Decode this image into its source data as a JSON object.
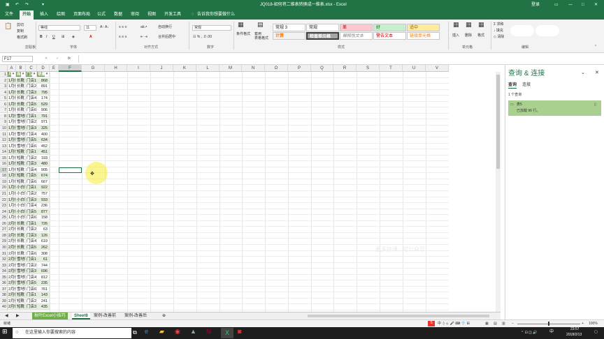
{
  "titlebar": {
    "doc_title": "JQ018-如何将二维表转换成一维表.xlsx - Excel",
    "login": "登录"
  },
  "menu": {
    "items": [
      "文件",
      "开始",
      "插入",
      "绘图",
      "页面布局",
      "公式",
      "数据",
      "审阅",
      "视图",
      "开发工具"
    ],
    "active": 1,
    "tell_me": "告诉我你想要做什么"
  },
  "ribbon": {
    "clipboard": {
      "cut": "剪切",
      "copy": "复制",
      "format_painter": "格式刷",
      "group": "剪贴板"
    },
    "font": {
      "name": "等线",
      "size": "11",
      "group": "字体"
    },
    "alignment": {
      "wrap": "自动换行",
      "merge": "合并后居中",
      "group": "对齐方式"
    },
    "number": {
      "format": "常规",
      "group": "数字"
    },
    "styles": {
      "cond_format": "条件格式",
      "table_format": "套用\n表格格式",
      "boxes": [
        "常规 3",
        "常规",
        "差",
        "好",
        "适中",
        "计算",
        "检查单元格",
        "解释性文本",
        "警告文本",
        "链接单元格"
      ],
      "group": "样式"
    },
    "cells": {
      "insert": "插入",
      "delete": "删除",
      "format": "格式",
      "group": "单元格"
    },
    "editing": {
      "sum": "求和",
      "fill": "填充",
      "clear": "清除",
      "group": "编辑"
    }
  },
  "formula": {
    "namebox": "F17",
    "fx": "fx",
    "content": ""
  },
  "columns": [
    "A",
    "B",
    "C",
    "D",
    "E",
    "F",
    "G",
    "H",
    "I",
    "J",
    "K",
    "L",
    "M",
    "N",
    "O",
    "P",
    "Q",
    "R",
    "S",
    "T",
    "U",
    "V"
  ],
  "header_row": [
    "月份",
    "商品",
    "门店",
    "销量"
  ],
  "rows": [
    [
      "1月份",
      "长靴",
      "门店1",
      "868"
    ],
    [
      "1月份",
      "长靴",
      "门店2",
      "891"
    ],
    [
      "1月份",
      "长靴",
      "门店3",
      "795"
    ],
    [
      "1月份",
      "长靴",
      "门店4",
      "174"
    ],
    [
      "1月份",
      "长靴",
      "门店5",
      "529"
    ],
    [
      "1月份",
      "长靴",
      "门店6",
      "906"
    ],
    [
      "1月份",
      "雪地靴",
      "门店1",
      "791"
    ],
    [
      "1月份",
      "雪地靴",
      "门店2",
      "971"
    ],
    [
      "1月份",
      "雪地靴",
      "门店3",
      "325"
    ],
    [
      "1月份",
      "雪地靴",
      "门店4",
      "400"
    ],
    [
      "1月份",
      "雪地靴",
      "门店5",
      "634"
    ],
    [
      "1月份",
      "雪地靴",
      "门店6",
      "452"
    ],
    [
      "1月份",
      "短靴",
      "门店1",
      "451"
    ],
    [
      "1月份",
      "短靴",
      "门店2",
      "193"
    ],
    [
      "1月份",
      "短靴",
      "门店3",
      "480"
    ],
    [
      "1月份",
      "短靴",
      "门店4",
      "905"
    ],
    [
      "1月份",
      "短靴",
      "门店5",
      "674"
    ],
    [
      "1月份",
      "短靴",
      "门店6",
      "667"
    ],
    [
      "1月份",
      "小白鞋",
      "门店1",
      "922"
    ],
    [
      "1月份",
      "小白鞋",
      "门店2",
      "757"
    ],
    [
      "1月份",
      "小白鞋",
      "门店3",
      "933"
    ],
    [
      "1月份",
      "小白鞋",
      "门店4",
      "236"
    ],
    [
      "1月份",
      "小白鞋",
      "门店5",
      "877"
    ],
    [
      "1月份",
      "小白鞋",
      "门店6",
      "158"
    ],
    [
      "2月份",
      "长靴",
      "门店1",
      "726"
    ],
    [
      "2月份",
      "长靴",
      "门店2",
      "63"
    ],
    [
      "2月份",
      "长靴",
      "门店3",
      "126"
    ],
    [
      "2月份",
      "长靴",
      "门店4",
      "619"
    ],
    [
      "2月份",
      "长靴",
      "门店5",
      "262"
    ],
    [
      "2月份",
      "长靴",
      "门店6",
      "308"
    ],
    [
      "2月份",
      "雪地靴",
      "门店1",
      "61"
    ],
    [
      "2月份",
      "雪地靴",
      "门店2",
      "744"
    ],
    [
      "2月份",
      "雪地靴",
      "门店3",
      "696"
    ],
    [
      "2月份",
      "雪地靴",
      "门店4",
      "812"
    ],
    [
      "2月份",
      "雪地靴",
      "门店5",
      "235"
    ],
    [
      "2月份",
      "雪地靴",
      "门店6",
      "761"
    ],
    [
      "2月份",
      "短靴",
      "门店1",
      "143"
    ],
    [
      "2月份",
      "短靴",
      "门店2",
      "241"
    ],
    [
      "2月份",
      "短靴",
      "门店3",
      "435"
    ]
  ],
  "sheets": [
    "秋叶Excel小技巧",
    "Sheet8",
    "案例-改善前",
    "案例-改善后"
  ],
  "active_sheet": 1,
  "status": {
    "ready": "就绪",
    "zoom": "100%"
  },
  "pane": {
    "title": "查询 & 连接",
    "tabs": [
      "查询",
      "连接"
    ],
    "count": "1 个查询",
    "query_name": "表5",
    "query_status": "已加载 96 行。"
  },
  "taskbar": {
    "search": "在这里输入你要搜索的内容",
    "time": "23:57",
    "date": "2018/2/13",
    "ime": "中"
  },
  "colors": {
    "green": "#217346",
    "band": "#e2efda",
    "header": "#70ad47",
    "query_bg": "#a9d08e"
  }
}
